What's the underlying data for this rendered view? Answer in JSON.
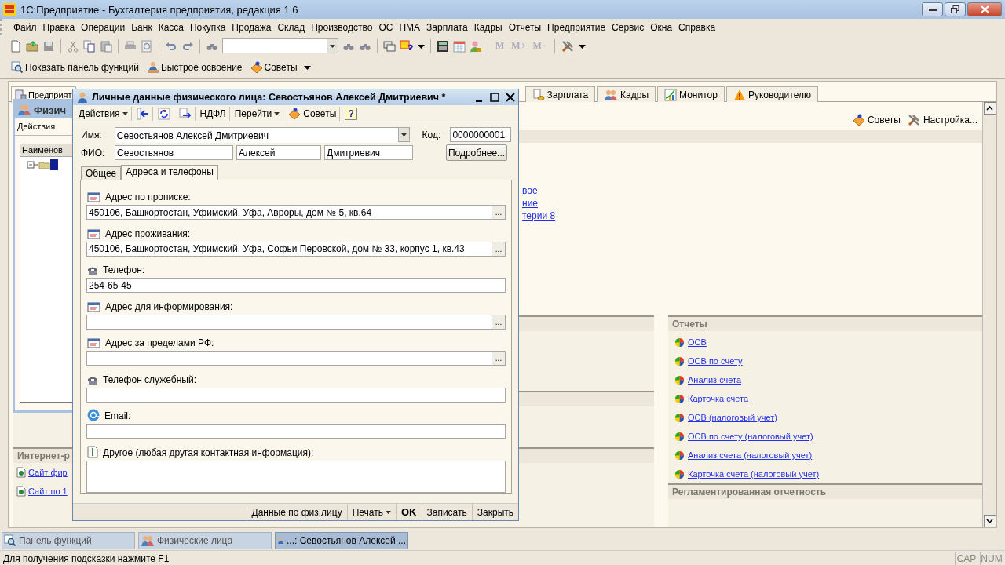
{
  "app": {
    "title": "1С:Предприятие - Бухгалтерия предприятия, редакция 1.6"
  },
  "menu": [
    {
      "label": "Файл"
    },
    {
      "label": "Правка"
    },
    {
      "label": "Операции"
    },
    {
      "label": "Банк"
    },
    {
      "label": "Касса"
    },
    {
      "label": "Покупка"
    },
    {
      "label": "Продажа"
    },
    {
      "label": "Склад"
    },
    {
      "label": "Производство"
    },
    {
      "label": "ОС"
    },
    {
      "label": "НМА"
    },
    {
      "label": "Зарплата"
    },
    {
      "label": "Кадры"
    },
    {
      "label": "Отчеты"
    },
    {
      "label": "Предприятие"
    },
    {
      "label": "Сервис"
    },
    {
      "label": "Окна"
    },
    {
      "label": "Справка"
    }
  ],
  "toolbar_memory": [
    "M",
    "M+",
    "M−"
  ],
  "quick_bar": [
    {
      "label": "Показать панель функций",
      "kind": "panel"
    },
    {
      "label": "Быстрое освоение",
      "kind": "learn"
    },
    {
      "label": "Советы",
      "kind": "tips"
    }
  ],
  "panel_window": {
    "tabs": [
      {
        "label": "Предприят",
        "selected": true
      },
      {
        "label": "Зарплата",
        "selected": false
      },
      {
        "label": "Кадры",
        "selected": false
      },
      {
        "label": "Монитор",
        "selected": false
      },
      {
        "label": "Руководителю",
        "selected": false
      }
    ],
    "actions": [
      {
        "label": "Советы",
        "kind": "tips"
      },
      {
        "label": "Настройка...",
        "kind": "settings"
      }
    ],
    "partial_links": [
      "вое",
      "ние",
      "терии 8"
    ],
    "internet": {
      "title": "Интернет-р",
      "links": [
        "Сайт фир",
        "Сайт по 1"
      ]
    },
    "reports": {
      "title": "Отчеты",
      "links": [
        "ОСВ",
        "ОСВ по счету",
        "Анализ счета",
        "Карточка счета",
        "ОСВ (налоговый учет)",
        "ОСВ по счету (налоговый учет)",
        "Анализ счета (налоговый учет)",
        "Карточка счета (налоговый учет)"
      ]
    },
    "regulated": {
      "title": "Регламентированная отчетность"
    }
  },
  "persons_window": {
    "title": "Физич",
    "action": "Действия",
    "column": "Наименов"
  },
  "dialog": {
    "title": "Личные данные физического лица: Севостьянов  Алексей Дмитриевич *",
    "toolbar": [
      {
        "label": "Действия",
        "kind": "menu"
      },
      {
        "kind": "icon"
      },
      {
        "kind": "icon"
      },
      {
        "kind": "icon"
      },
      {
        "label": "НДФЛ",
        "kind": "text"
      },
      {
        "label": "Перейти",
        "kind": "menu"
      },
      {
        "label": "Советы",
        "kind": "tips"
      },
      {
        "label": "?",
        "kind": "help"
      }
    ],
    "name_label": "Имя:",
    "name_value": "Севостьянов  Алексей Дмитриевич",
    "code_label": "Код:",
    "code_value": "0000000001",
    "fio_label": "ФИО:",
    "fio": [
      "Севостьянов",
      "Алексей",
      "Дмитриевич"
    ],
    "more_button": "Подробнее...",
    "tabs": [
      {
        "label": "Общее",
        "selected": false
      },
      {
        "label": "Адреса и телефоны",
        "selected": true
      }
    ],
    "fields": [
      {
        "kind": "address",
        "label": "Адрес по прописке:",
        "value": "450106, Башкортостан, Уфимский, Уфа, Авроры, дом № 5, кв.64",
        "button": "..."
      },
      {
        "kind": "address",
        "label": "Адрес проживания:",
        "value": "450106, Башкортостан, Уфимский, Уфа, Софьи Перовской, дом № 33, корпус 1, кв.43",
        "button": "..."
      },
      {
        "kind": "phone",
        "label": "Телефон:",
        "value": "254-65-45"
      },
      {
        "kind": "address",
        "label": "Адрес для информирования:",
        "button": "..."
      },
      {
        "kind": "address",
        "label": "Адрес за пределами РФ:",
        "button": "..."
      },
      {
        "kind": "phone",
        "label": "Телефон служебный:"
      },
      {
        "kind": "email",
        "label": "Email:"
      },
      {
        "kind": "other",
        "label": "Другое (любая другая контактная информация):"
      }
    ],
    "footer": [
      {
        "label": "Данные по физ.лицу",
        "kind": "plain"
      },
      {
        "label": "Печать",
        "kind": "menu"
      },
      {
        "label": "OK",
        "kind": "default"
      },
      {
        "label": "Записать",
        "kind": "plain"
      },
      {
        "label": "Закрыть",
        "kind": "plain"
      }
    ]
  },
  "taskbar": [
    {
      "label": "Панель функций",
      "kind": "panel",
      "selected": false
    },
    {
      "label": "Физические лица",
      "kind": "people",
      "selected": false
    },
    {
      "label": "...: Севостьянов  Алексей ...",
      "kind": "person",
      "selected": true
    }
  ],
  "status": {
    "hint": "Для получения подсказки нажмите F1",
    "indicators": [
      "CAP",
      "NUM"
    ]
  }
}
